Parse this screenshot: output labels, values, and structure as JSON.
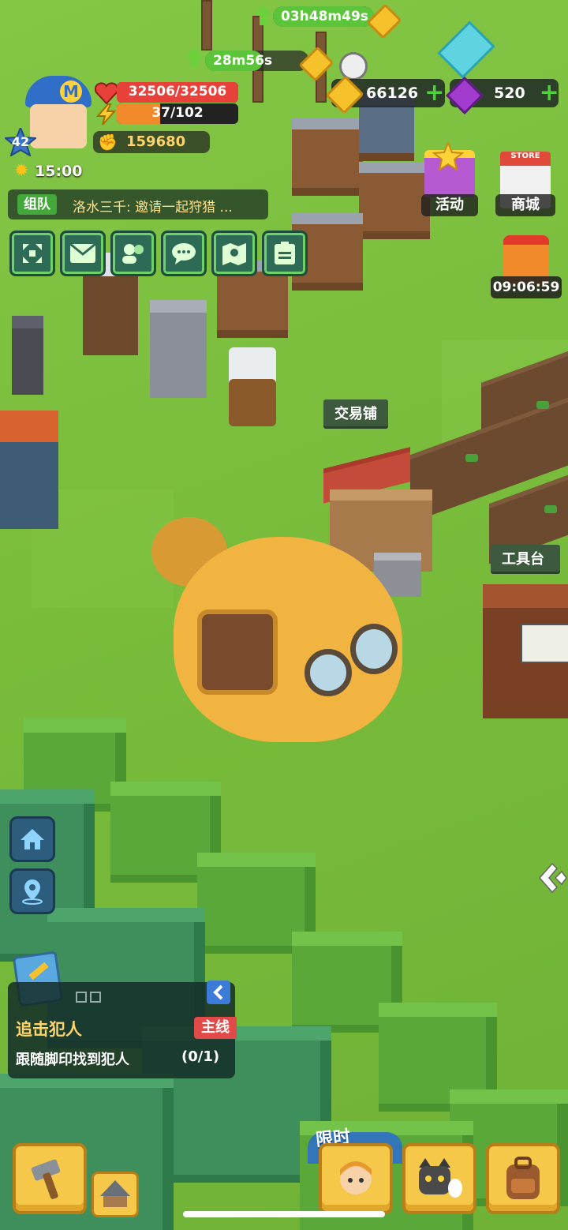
{
  "hud": {
    "timers": [
      {
        "text": "03h48m49s",
        "progress": 1.0
      },
      {
        "text": "28m56s",
        "progress": 0.55
      }
    ],
    "player": {
      "level": "42",
      "avatar_letter": "M",
      "game_time": "15:00"
    },
    "hp": {
      "text": "32506/32506",
      "fraction": 1.0,
      "color": "#e8413a"
    },
    "energy": {
      "text": "37/102",
      "fraction": 0.36,
      "color": "#f08a2a"
    },
    "power": {
      "text": "159680"
    },
    "gold": {
      "value": "66126"
    },
    "gems": {
      "value": "520"
    }
  },
  "chat": {
    "channel": "组队",
    "message": "洛水三千: 邀请一起狩猎 ..."
  },
  "action_icons": [
    "expand-icon",
    "mail-icon",
    "friends-icon",
    "chat-icon",
    "map-icon",
    "id-card-icon"
  ],
  "top_right": {
    "event_label": "活动",
    "store_sign": "STORE",
    "store_label": "商城",
    "gift_timer": "09:06:59"
  },
  "world_labels": {
    "trade_shop": "交易铺",
    "workbench": "工具台"
  },
  "quest": {
    "title": "追击犯人",
    "tag": "主线",
    "description": "跟随脚印找到犯人",
    "progress": "(0/1)"
  },
  "event_banner": "限时",
  "colors": {
    "grass": "#7bbf3e",
    "accent_green": "#4fcf3a",
    "quest_tag": "#e24a4a",
    "bottom_btn": "#f6c84a"
  }
}
